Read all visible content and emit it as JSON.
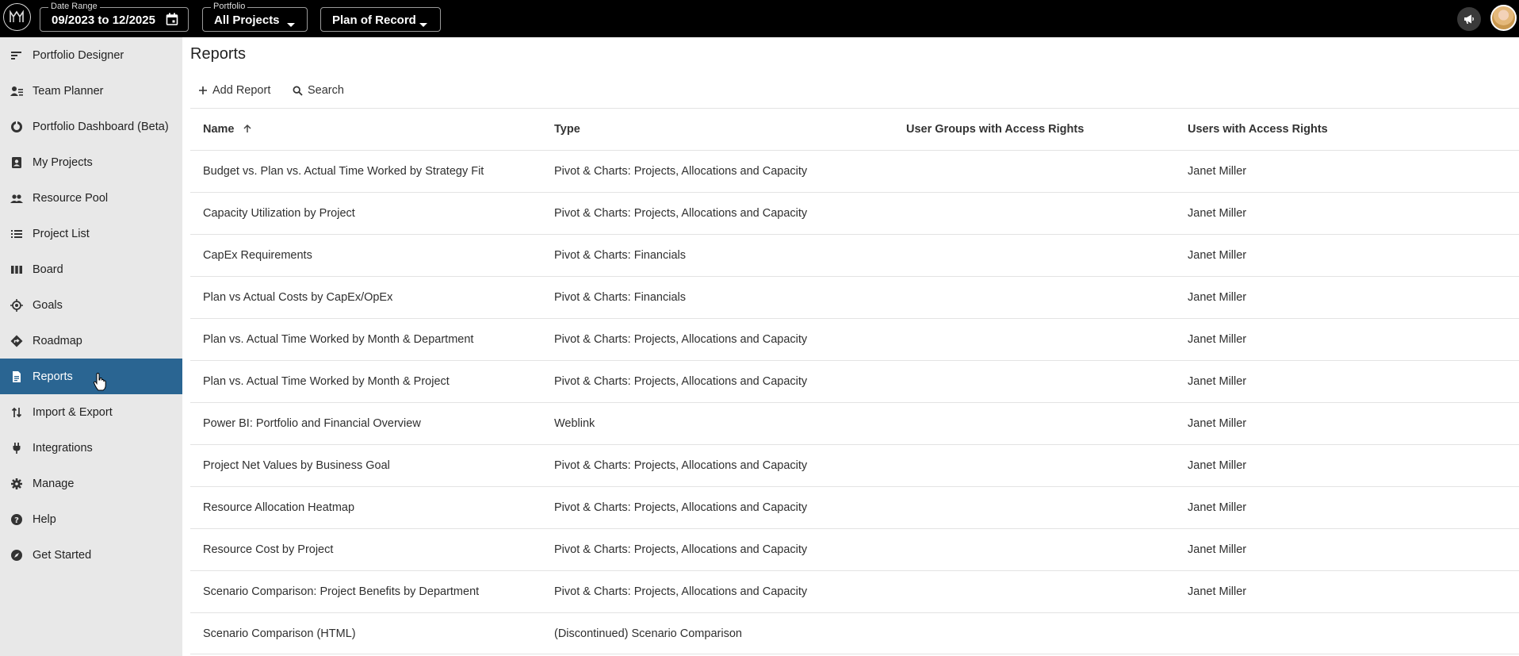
{
  "topbar": {
    "date_range_legend": "Date Range",
    "date_range_value": "09/2023 to 12/2025",
    "portfolio_legend": "Portfolio",
    "portfolio_value": "All Projects",
    "plan_value": "Plan of Record"
  },
  "sidebar": {
    "items": [
      {
        "label": "Portfolio Designer",
        "icon": "portfolio-designer-icon"
      },
      {
        "label": "Team Planner",
        "icon": "team-planner-icon"
      },
      {
        "label": "Portfolio Dashboard (Beta)",
        "icon": "dashboard-icon"
      },
      {
        "label": "My Projects",
        "icon": "my-projects-icon"
      },
      {
        "label": "Resource Pool",
        "icon": "people-icon"
      },
      {
        "label": "Project List",
        "icon": "list-icon"
      },
      {
        "label": "Board",
        "icon": "board-icon"
      },
      {
        "label": "Goals",
        "icon": "target-icon"
      },
      {
        "label": "Roadmap",
        "icon": "roadmap-icon"
      },
      {
        "label": "Reports",
        "icon": "document-icon"
      },
      {
        "label": "Import & Export",
        "icon": "import-export-icon"
      },
      {
        "label": "Integrations",
        "icon": "plug-icon"
      },
      {
        "label": "Manage",
        "icon": "gear-icon"
      },
      {
        "label": "Help",
        "icon": "help-icon"
      },
      {
        "label": "Get Started",
        "icon": "compass-icon"
      }
    ],
    "active": "Reports"
  },
  "main": {
    "title": "Reports",
    "add_report_label": "Add Report",
    "search_label": "Search",
    "columns": [
      "Name",
      "Type",
      "User Groups with Access Rights",
      "Users with Access Rights"
    ],
    "rows": [
      {
        "name": "Budget vs. Plan vs. Actual Time Worked by Strategy Fit",
        "type": "Pivot & Charts: Projects, Allocations and Capacity",
        "groups": "",
        "users": "Janet Miller"
      },
      {
        "name": "Capacity Utilization by Project",
        "type": "Pivot & Charts: Projects, Allocations and Capacity",
        "groups": "",
        "users": "Janet Miller"
      },
      {
        "name": "CapEx Requirements",
        "type": "Pivot & Charts: Financials",
        "groups": "",
        "users": "Janet Miller"
      },
      {
        "name": "Plan vs Actual Costs by CapEx/OpEx",
        "type": "Pivot & Charts: Financials",
        "groups": "",
        "users": "Janet Miller"
      },
      {
        "name": "Plan vs. Actual Time Worked by Month & Department",
        "type": "Pivot & Charts: Projects, Allocations and Capacity",
        "groups": "",
        "users": "Janet Miller"
      },
      {
        "name": "Plan vs. Actual Time Worked by Month & Project",
        "type": "Pivot & Charts: Projects, Allocations and Capacity",
        "groups": "",
        "users": "Janet Miller"
      },
      {
        "name": "Power BI: Portfolio and Financial Overview",
        "type": "Weblink",
        "groups": "",
        "users": "Janet Miller"
      },
      {
        "name": "Project Net Values by Business Goal",
        "type": "Pivot & Charts: Projects, Allocations and Capacity",
        "groups": "",
        "users": "Janet Miller"
      },
      {
        "name": "Resource Allocation Heatmap",
        "type": "Pivot & Charts: Projects, Allocations and Capacity",
        "groups": "",
        "users": "Janet Miller"
      },
      {
        "name": "Resource Cost by Project",
        "type": "Pivot & Charts: Projects, Allocations and Capacity",
        "groups": "",
        "users": "Janet Miller"
      },
      {
        "name": "Scenario Comparison: Project Benefits by Department",
        "type": "Pivot & Charts: Projects, Allocations and Capacity",
        "groups": "",
        "users": "Janet Miller"
      },
      {
        "name": "Scenario Comparison (HTML)",
        "type": "(Discontinued) Scenario Comparison",
        "groups": "",
        "users": ""
      }
    ]
  },
  "colors": {
    "topbar": "#000000",
    "sidebar": "#e8e8e8",
    "active": "#2a6592"
  }
}
